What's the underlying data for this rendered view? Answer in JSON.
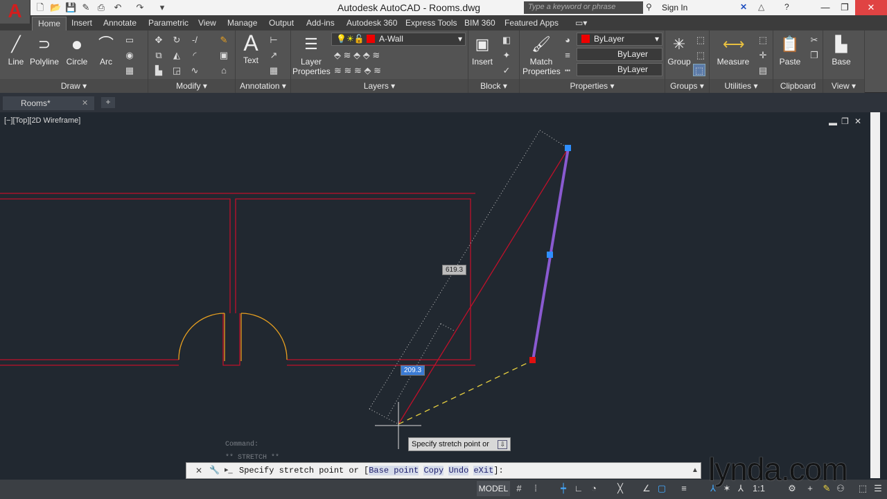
{
  "app": {
    "title": "Autodesk AutoCAD - Rooms.dwg",
    "search_placeholder": "Type a keyword or phrase",
    "sign_in": "Sign In"
  },
  "ribbon_tabs": [
    "Home",
    "Insert",
    "Annotate",
    "Parametric",
    "View",
    "Manage",
    "Output",
    "Add-ins",
    "Autodesk 360",
    "Express Tools",
    "BIM 360",
    "Featured Apps"
  ],
  "draw": {
    "line": "Line",
    "polyline": "Polyline",
    "circle": "Circle",
    "arc": "Arc",
    "title": "Draw ▾"
  },
  "modify": {
    "title": "Modify ▾"
  },
  "annotation": {
    "text": "Text",
    "title": "Annotation ▾"
  },
  "layers": {
    "layer_properties": "Layer Properties",
    "current_layer": "A-Wall",
    "title": "Layers ▾"
  },
  "block": {
    "insert": "Insert",
    "title": "Block ▾"
  },
  "properties": {
    "match": "Match Properties",
    "color": "ByLayer",
    "linetype": "ByLayer",
    "lineweight": "ByLayer",
    "title": "Properties ▾"
  },
  "groups": {
    "group": "Group",
    "title": "Groups ▾"
  },
  "utilities": {
    "measure": "Measure",
    "title": "Utilities ▾"
  },
  "clipboard": {
    "paste": "Paste",
    "title": "Clipboard"
  },
  "view": {
    "base": "Base",
    "title": "View ▾"
  },
  "file_tab": "Rooms*",
  "viewport_label": "[−][Top][2D Wireframe]",
  "dimensions": {
    "length": "619.3",
    "angle": "209.3"
  },
  "tooltip": "Specify stretch point or",
  "command_history": [
    "Command:",
    "** STRETCH **"
  ],
  "command": {
    "prefix": "Specify stretch point or [",
    "options": [
      "Base point",
      "Copy",
      "Undo",
      "eXit"
    ],
    "suffix": "]:"
  },
  "status": {
    "model": "MODEL",
    "scale": "1:1"
  },
  "watermark": "lynda.com",
  "colors": {
    "wall": "#c0102a",
    "door": "#e8a020",
    "selected": "#8a5ad0",
    "grip": "#2f8fff"
  }
}
